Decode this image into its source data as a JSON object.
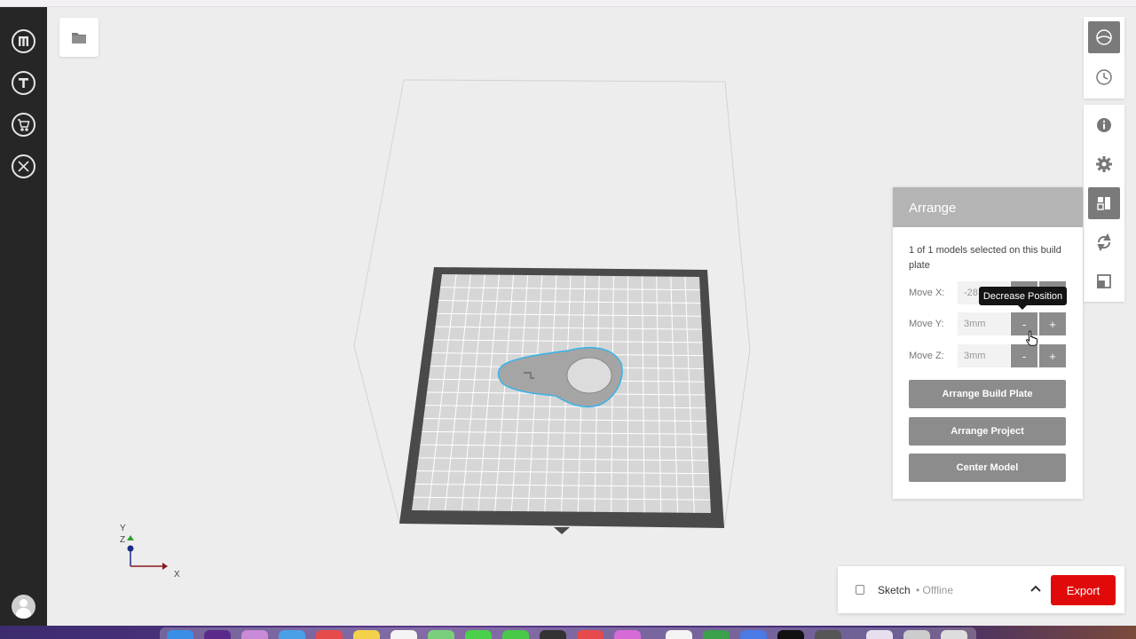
{
  "sidebar": {
    "items": [
      {
        "name": "makerbot-logo",
        "glyph": "M"
      },
      {
        "name": "thingiverse",
        "glyph": "T"
      },
      {
        "name": "store"
      },
      {
        "name": "utilities"
      }
    ]
  },
  "arrange_panel": {
    "title": "Arrange",
    "description": "1 of 1 models selected on this build plate",
    "move_x": {
      "label": "Move X:",
      "value": "-28"
    },
    "move_y": {
      "label": "Move Y:",
      "value": "3mm"
    },
    "move_z": {
      "label": "Move Z:",
      "value": "3mm"
    },
    "minus_label": "-",
    "plus_label": "+",
    "buttons": {
      "arrange_build_plate": "Arrange Build Plate",
      "arrange_project": "Arrange Project",
      "center_model": "Center Model"
    }
  },
  "tooltip": "Decrease Position",
  "axes": {
    "x": "X",
    "y": "Y",
    "z": "Z"
  },
  "printer": {
    "name": "Sketch",
    "status": "• Offline",
    "export_label": "Export"
  },
  "colors": {
    "export": "#e10a0a",
    "panel_header": "#b4b4b4",
    "selection_outline": "#3ab4e6",
    "sidebar": "#262626"
  },
  "right_toolbar": {
    "view_icons": [
      "view-sphere-icon",
      "view-history-icon"
    ],
    "tool_icons": [
      "info-icon",
      "settings-gear-icon",
      "arrange-icon",
      "rotate-icon",
      "scale-icon"
    ]
  }
}
